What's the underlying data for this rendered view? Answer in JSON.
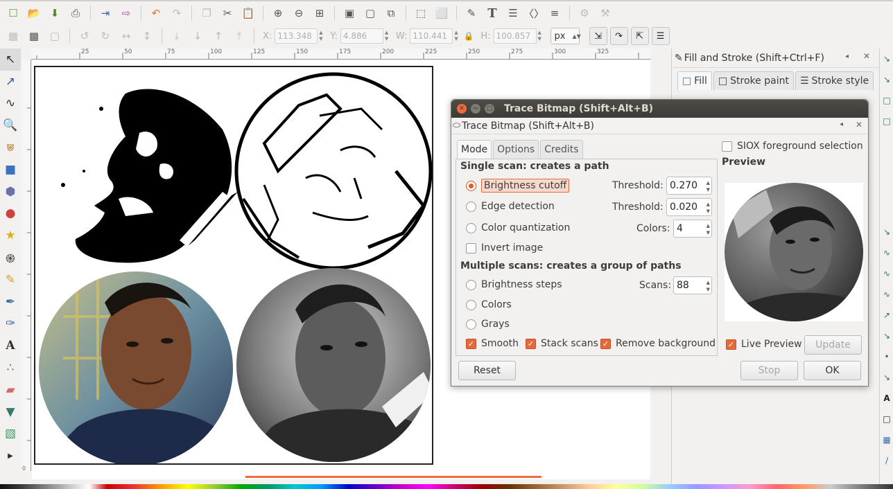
{
  "toolbar1": {
    "icons": [
      "new-document-icon",
      "open-icon",
      "save-icon",
      "print-icon",
      "import-icon",
      "export-icon",
      "undo-icon",
      "redo-icon",
      "duplicate-icon",
      "cut-icon",
      "paste-icon",
      "zoom-selection-icon",
      "zoom-drawing-icon",
      "zoom-page-icon",
      "group-icon",
      "ungroup-icon",
      "clone-icon",
      "transform-icon",
      "align-icon",
      "node-editor-icon",
      "text-tool-icon",
      "layers-icon",
      "xml-editor-icon",
      "align-distribute-icon",
      "preferences-icon",
      "tweak-icon"
    ]
  },
  "toolbar2": {
    "x_label": "X:",
    "x_value": "113.348",
    "y_label": "Y:",
    "y_value": "4.886",
    "w_label": "W:",
    "w_value": "110.441",
    "h_label": "H:",
    "h_value": "100.857",
    "unit": "px"
  },
  "ruler": {
    "h_ticks": [
      "25",
      "50",
      "75",
      "100",
      "125",
      "150",
      "175",
      "200",
      "225",
      "250",
      "275",
      "300",
      "325"
    ],
    "v_ticks": [
      "1 5 0",
      "1 7 5",
      "2 0 0",
      "2 2 5",
      "2 5 0",
      "2 7 5",
      "3 0 0",
      "3 2 5",
      "3 5 0",
      "3 7 5",
      "4 0 0",
      "0"
    ]
  },
  "fill_panel": {
    "title": "Fill and Stroke (Shift+Ctrl+F)",
    "tabs": [
      "Fill",
      "Stroke paint",
      "Stroke style"
    ]
  },
  "dialog": {
    "window_title": "Trace Bitmap (Shift+Alt+B)",
    "sub_title": "Trace Bitmap (Shift+Alt+B)",
    "tabs": [
      "Mode",
      "Options",
      "Credits"
    ],
    "single_scan_heading": "Single scan: creates a path",
    "brightness_cutoff": "Brightness cutoff",
    "edge_detection": "Edge detection",
    "color_quantization": "Color quantization",
    "invert_image": "Invert image",
    "threshold_label": "Threshold:",
    "threshold1": "0.270",
    "threshold2": "0.020",
    "colors_label": "Colors:",
    "colors_value": "4",
    "multiple_heading": "Multiple scans: creates a group of paths",
    "brightness_steps": "Brightness steps",
    "colors_option": "Colors",
    "grays_option": "Grays",
    "scans_label": "Scans:",
    "scans_value": "88",
    "smooth": "Smooth",
    "stack_scans": "Stack scans",
    "remove_background": "Remove background",
    "siox": "SIOX foreground selection",
    "preview_heading": "Preview",
    "live_preview": "Live Preview",
    "update_btn": "Update",
    "reset_btn": "Reset",
    "stop_btn": "Stop",
    "ok_btn": "OK"
  },
  "colors": {
    "accent": "#e36a3a",
    "titlebar": "#3c3b37",
    "scroll_thumb": "#ef6a3c"
  }
}
